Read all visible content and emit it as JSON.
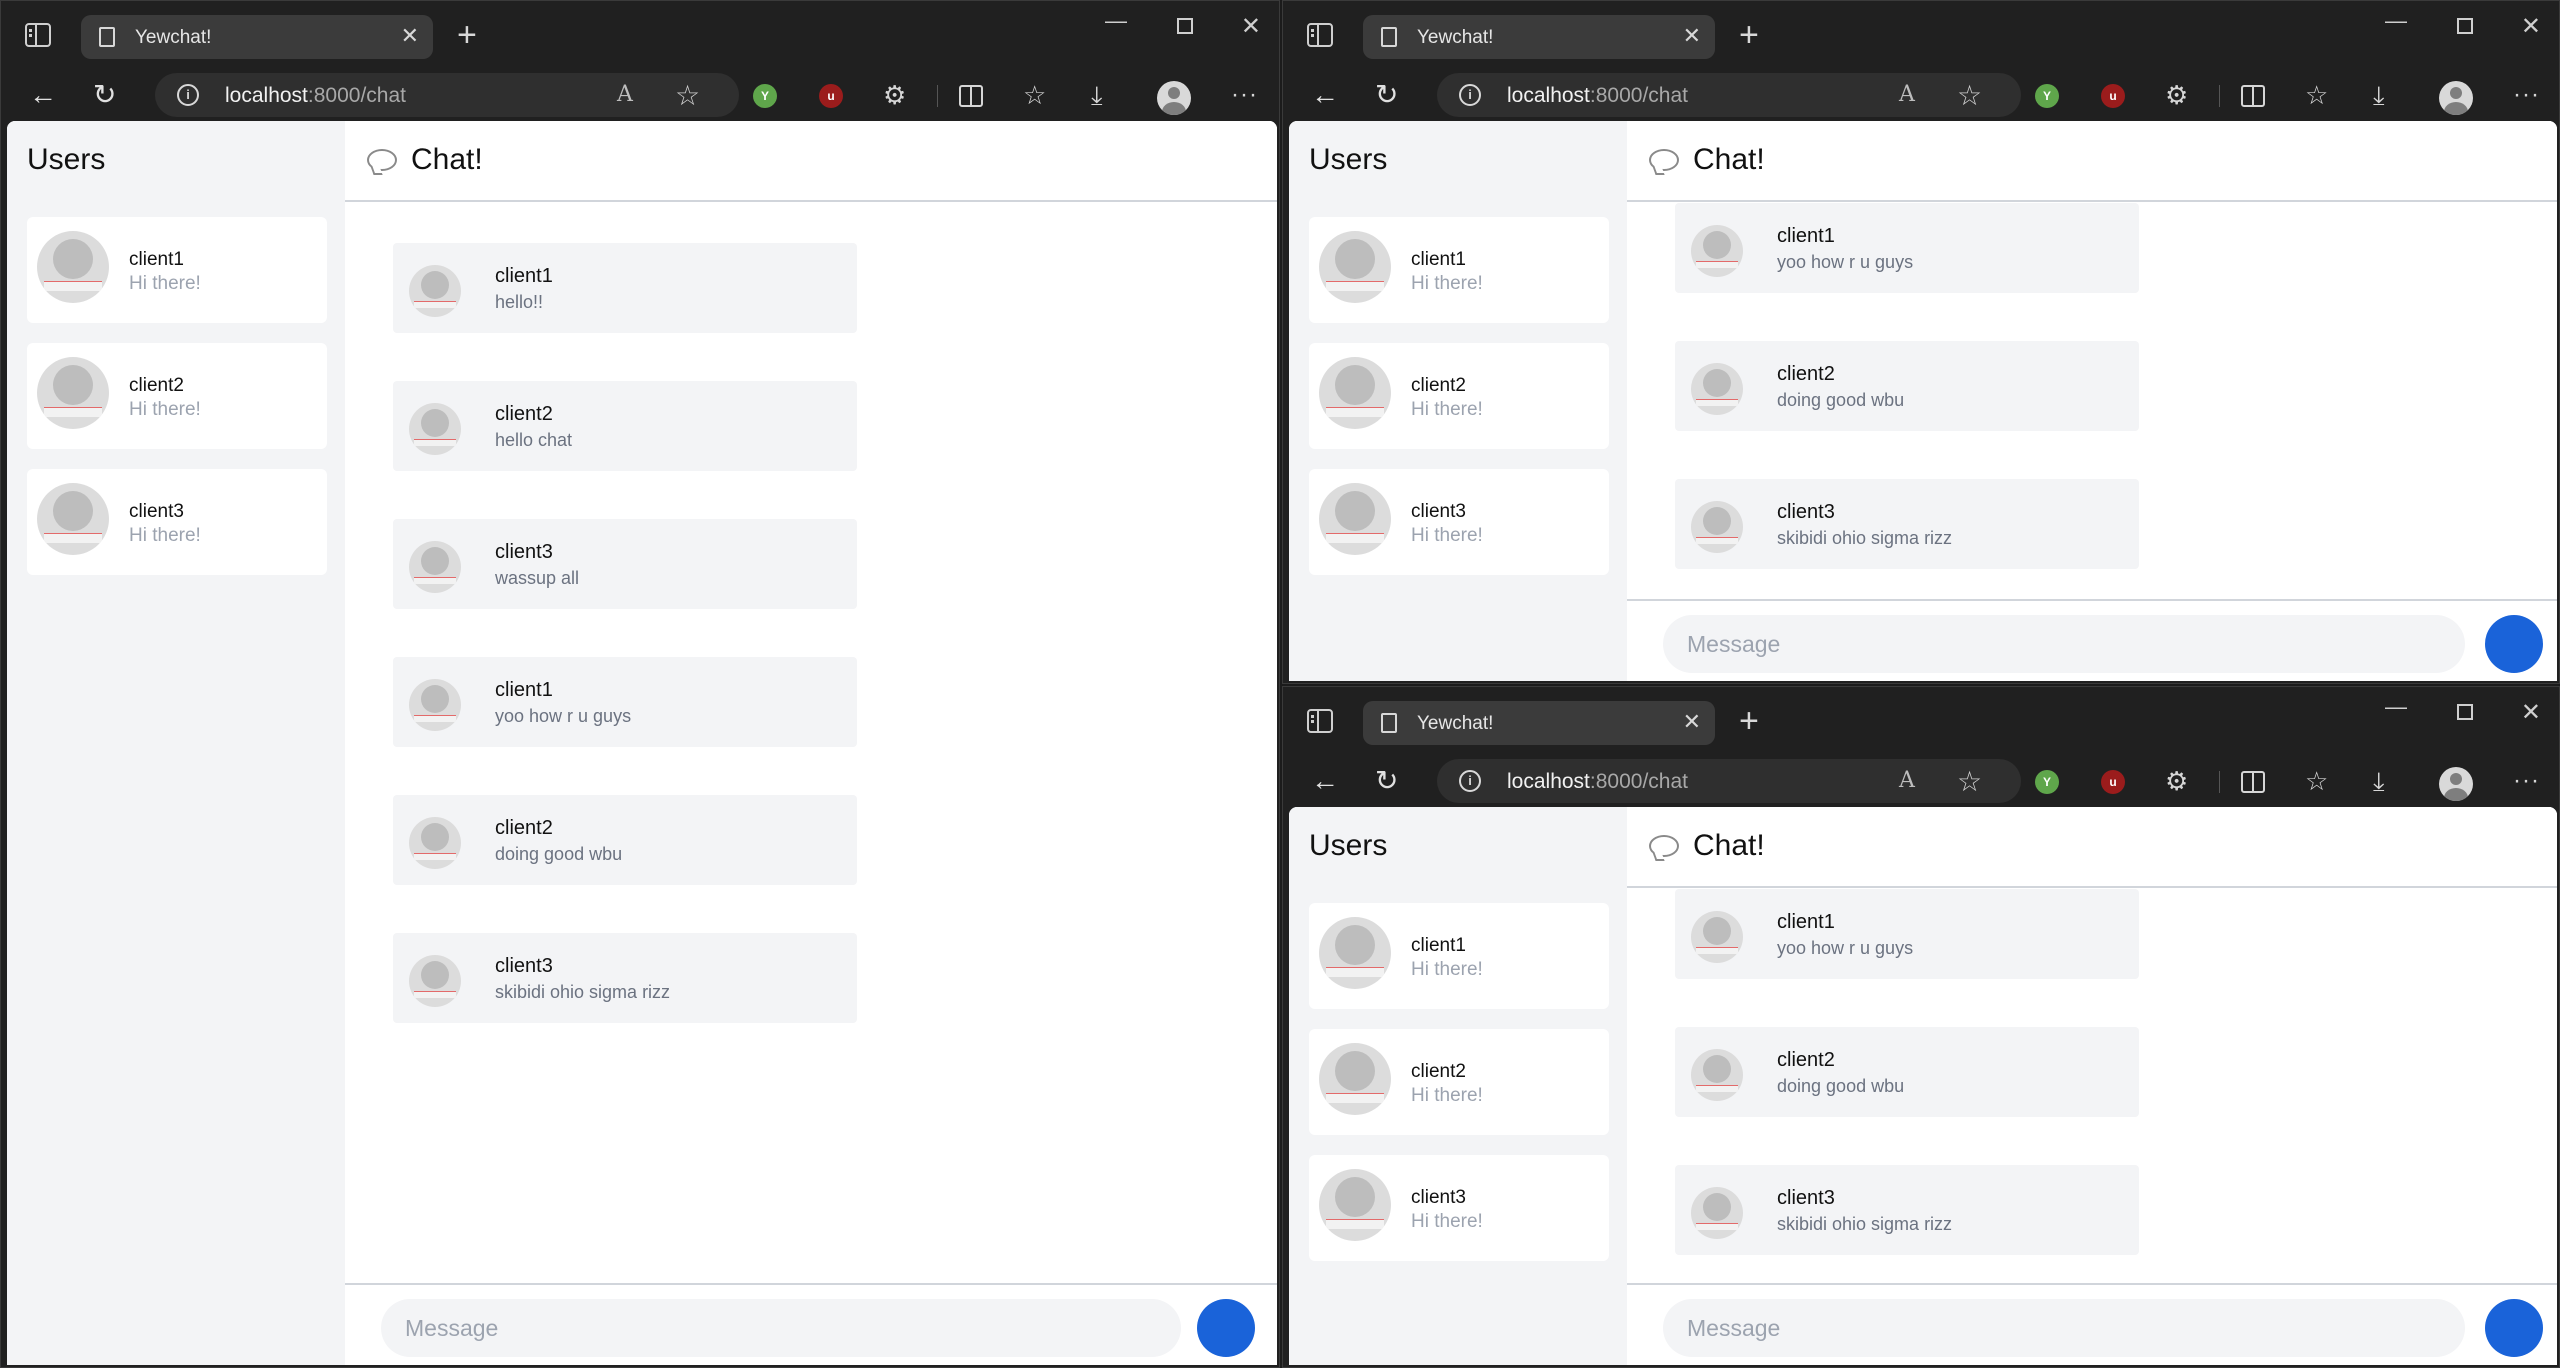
{
  "browser": {
    "tab_title": "Yewchat!",
    "tab_close": "✕",
    "new_tab": "+",
    "url_host": "localhost",
    "url_path": ":8000/chat",
    "info_glyph": "i",
    "read_aloud_glyph": "A",
    "favorite_glyph": "☆",
    "back_glyph": "←",
    "reload_glyph": "↻",
    "extensions_glyph": "⚙",
    "favorites_glyph": "☆",
    "downloads_glyph": "⤓",
    "more_glyph": "···",
    "minimize_glyph": "—",
    "close_glyph": "✕",
    "ext_green_glyph": "Y",
    "ext_red_glyph": "u"
  },
  "users_pane": {
    "title": "Users",
    "users": [
      {
        "name": "client1",
        "status": "Hi there!"
      },
      {
        "name": "client2",
        "status": "Hi there!"
      },
      {
        "name": "client3",
        "status": "Hi there!"
      }
    ]
  },
  "chat": {
    "title": "Chat!",
    "messages": [
      {
        "user": "client1",
        "text": "hello!!"
      },
      {
        "user": "client2",
        "text": "hello chat"
      },
      {
        "user": "client3",
        "text": "wassup all"
      },
      {
        "user": "client1",
        "text": "yoo how r u guys"
      },
      {
        "user": "client2",
        "text": "doing good wbu"
      },
      {
        "user": "client3",
        "text": "skibidi ohio sigma rizz"
      }
    ],
    "input_placeholder": "Message"
  },
  "colors": {
    "accent": "#1a63d9",
    "sidebar_bg": "#f3f4f6",
    "muted_text": "#9ca3af"
  }
}
